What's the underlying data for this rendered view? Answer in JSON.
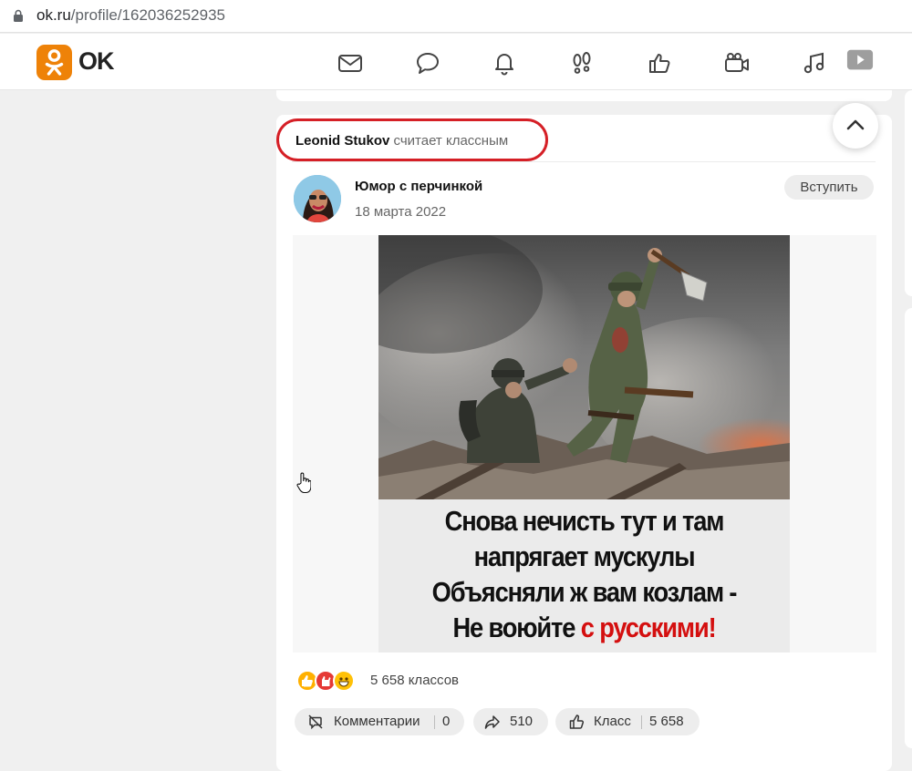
{
  "browser": {
    "url_host": "ok.ru",
    "url_path": "/profile/162036252935"
  },
  "nav": {
    "logo_text": "OK",
    "icons": [
      "mail-icon",
      "discussions-icon",
      "notifications-icon",
      "guests-icon",
      "events-icon",
      "video-icon",
      "music-icon",
      "video-showcase-icon"
    ]
  },
  "post": {
    "actor_name": "Leonid Stukov",
    "actor_action": "считает классным",
    "group_name": "Юмор с перчинкой",
    "date": "18 марта 2022",
    "join_label": "Вступить",
    "caption_lines": [
      "Снова нечисть тут и там",
      "напрягает мускулы",
      "Объясняли ж вам козлам -"
    ],
    "caption_last_prefix": "Не воюйте ",
    "caption_last_red": "с русскими",
    "caption_last_suffix": "!",
    "reactions_count": "5 658 классов",
    "comments_label": "Комментарии",
    "comments_count": "0",
    "shares_count": "510",
    "like_label": "Класс",
    "like_count": "5 658"
  },
  "colors": {
    "brand_orange": "#ee8208",
    "highlight_red": "#d51f26",
    "caption_red": "#d40f0f"
  }
}
